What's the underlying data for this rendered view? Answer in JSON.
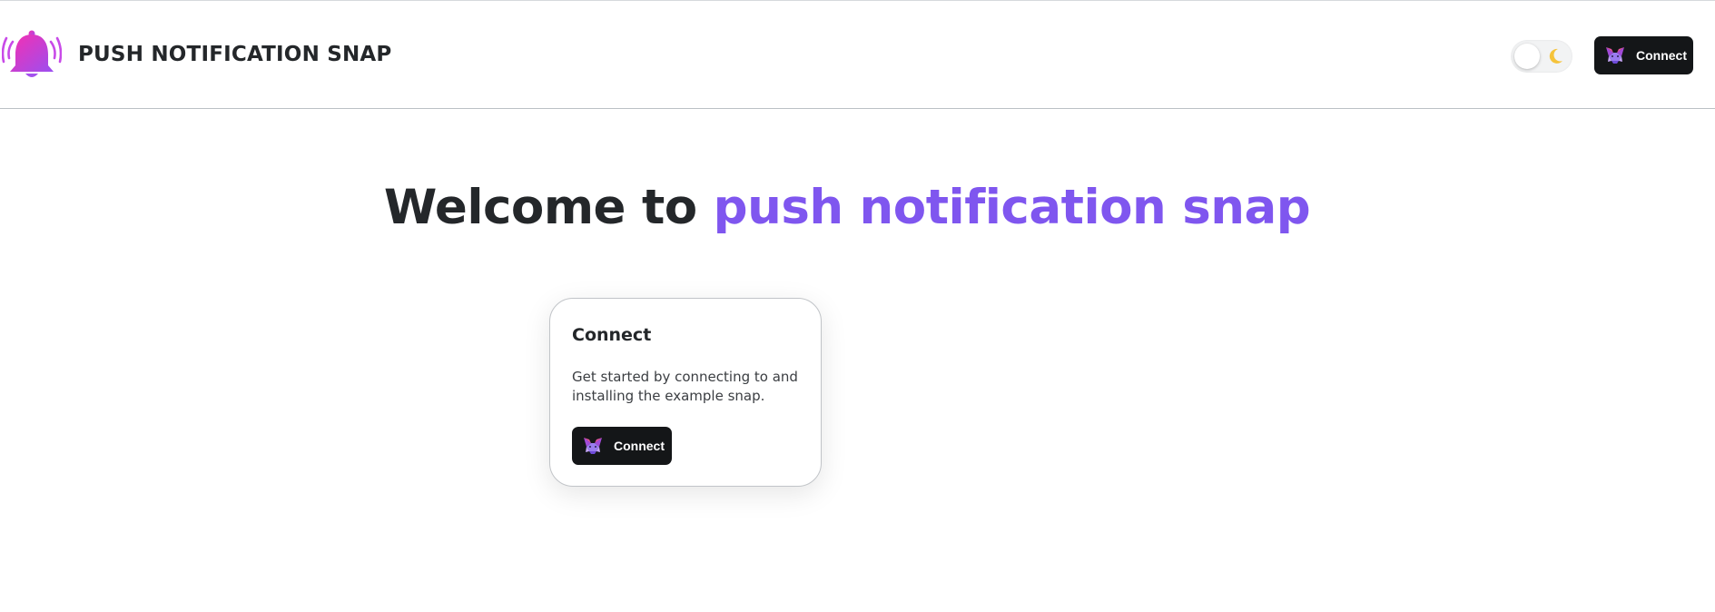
{
  "header": {
    "logo_icon": "bell-notification-icon",
    "title": "PUSH NOTIFICATION SNAP",
    "theme_toggle": {
      "icon": "moon-icon",
      "state": "light"
    },
    "connect_button": {
      "label": "Connect",
      "icon": "metamask-fox-icon"
    }
  },
  "hero": {
    "heading_prefix": "Welcome to",
    "heading_accent": "push notification snap"
  },
  "connect_card": {
    "title": "Connect",
    "description": "Get started by connecting to and installing the example snap.",
    "button": {
      "label": "Connect",
      "icon": "metamask-fox-icon"
    }
  },
  "colors": {
    "accent": "#7f56ef",
    "button_bg": "#141618",
    "text": "#24272a",
    "logo_gradient": [
      "#f62fb1",
      "#a451ee"
    ]
  }
}
